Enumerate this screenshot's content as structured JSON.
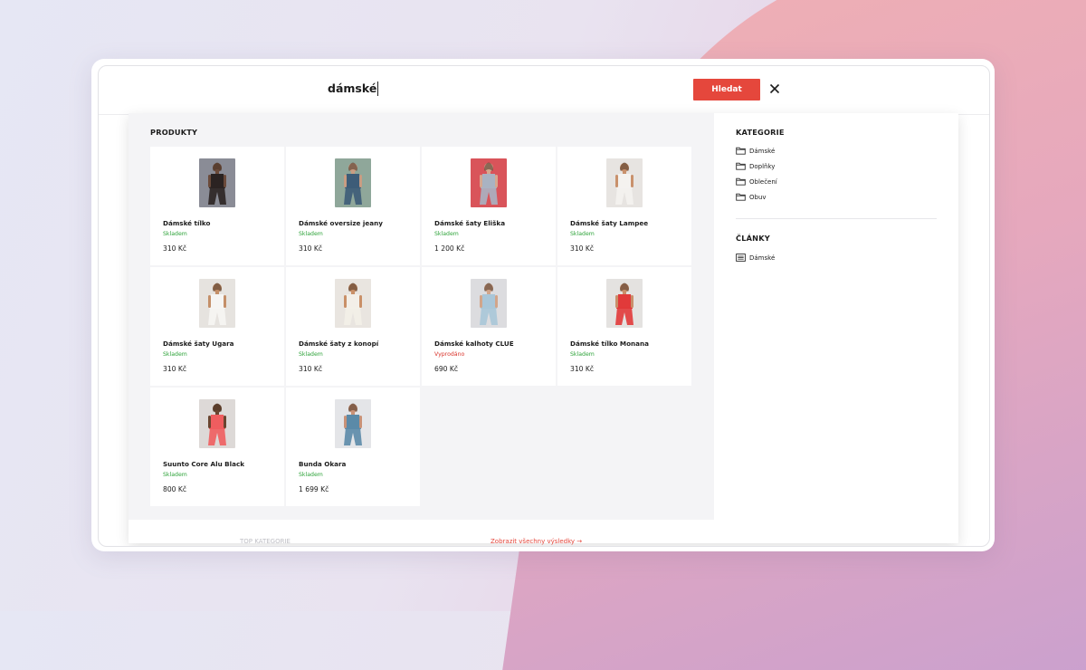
{
  "search": {
    "query": "dámské",
    "button_label": "Hledat"
  },
  "products": {
    "title": "PRODUKTY",
    "items": [
      {
        "name": "Dámské tílko",
        "stock": "Skladem",
        "in_stock": true,
        "price": "310 Kč",
        "colors": {
          "bg": "#8a8c96",
          "figure": "#2b2322",
          "skin": "#6b4a3a"
        }
      },
      {
        "name": "Dámské oversize jeany",
        "stock": "Skladem",
        "in_stock": true,
        "price": "310 Kč",
        "colors": {
          "bg": "#8fa79a",
          "figure": "#3d5c78",
          "skin": "#c99c82"
        }
      },
      {
        "name": "Dámské šaty Eliška",
        "stock": "Skladem",
        "in_stock": true,
        "price": "1 200 Kč",
        "colors": {
          "bg": "#d9545a",
          "figure": "#a9b3c2",
          "skin": "#d6a88f"
        }
      },
      {
        "name": "Dámské šaty Lampee",
        "stock": "Skladem",
        "in_stock": true,
        "price": "310 Kč",
        "colors": {
          "bg": "#e7e4e1",
          "figure": "#f4f2ef",
          "skin": "#c9916c"
        }
      },
      {
        "name": "Dámské šaty Ugara",
        "stock": "Skladem",
        "in_stock": true,
        "price": "310 Kč",
        "colors": {
          "bg": "#e6e3df",
          "figure": "#f6f5f3",
          "skin": "#c48f68"
        }
      },
      {
        "name": "Dámské šaty z konopí",
        "stock": "Skladem",
        "in_stock": true,
        "price": "310 Kč",
        "colors": {
          "bg": "#e9e5e0",
          "figure": "#f3efe8",
          "skin": "#c99068"
        }
      },
      {
        "name": "Dámské kalhoty CLUE",
        "stock": "Vyprodáno",
        "in_stock": false,
        "price": "690 Kč",
        "colors": {
          "bg": "#dcdcdf",
          "figure": "#a9c6d8",
          "skin": "#d2a58a"
        }
      },
      {
        "name": "Dámské tílko Monana",
        "stock": "Skladem",
        "in_stock": true,
        "price": "310 Kč",
        "colors": {
          "bg": "#e4e2e0",
          "figure": "#e13a3a",
          "skin": "#c98f6a"
        }
      },
      {
        "name": "Suunto Core Alu Black",
        "stock": "Skladem",
        "in_stock": true,
        "price": "800 Kč",
        "colors": {
          "bg": "#ddd9d7",
          "figure": "#ef5d5f",
          "skin": "#6a4530"
        }
      },
      {
        "name": "Bunda Okara",
        "stock": "Skladem",
        "in_stock": true,
        "price": "1 699 Kč",
        "colors": {
          "bg": "#e4e5e8",
          "figure": "#5b8aa8",
          "skin": "#c99277"
        }
      }
    ]
  },
  "categories": {
    "title": "KATEGORIE",
    "items": [
      "Dámské",
      "Doplňky",
      "Oblečení",
      "Obuv"
    ]
  },
  "articles": {
    "title": "ČLÁNKY",
    "items": [
      "Dámské"
    ]
  },
  "footer": {
    "show_all": "Zobrazit všechny výsledky  →",
    "ghost": "TOP KATEGORIE"
  },
  "colors": {
    "accent": "#e5473c",
    "in_stock": "#2ea33a",
    "sold_out": "#d9332b"
  }
}
